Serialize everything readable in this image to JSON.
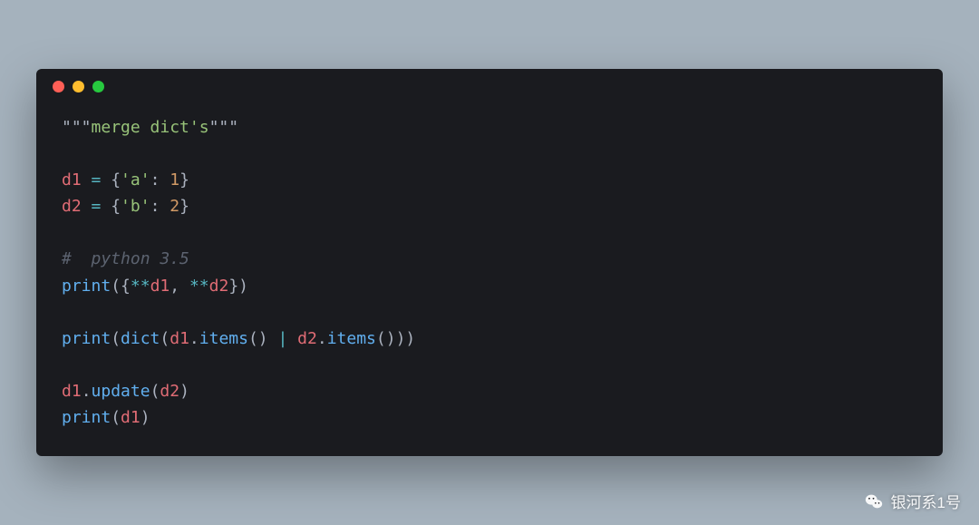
{
  "colors": {
    "page_bg": "#a5b2bd",
    "window_bg": "#1a1b1f",
    "dot_red": "#ff5f56",
    "dot_yellow": "#ffbd2e",
    "dot_green": "#27c93f",
    "string": "#98c379",
    "variable": "#e06c75",
    "operator": "#56b6c2",
    "number": "#d19a66",
    "comment": "#5c6370",
    "function": "#61afef",
    "text": "#abb2bf"
  },
  "code": {
    "docstring_quote": "\"\"\"",
    "docstring_text": "merge dict's",
    "d1_name": "d1",
    "d2_name": "d2",
    "eq": " = ",
    "lbrace": "{",
    "rbrace": "}",
    "key_a": "'a'",
    "key_b": "'b'",
    "colon": ": ",
    "val_1": "1",
    "val_2": "2",
    "comment_line": "#  python 3.5",
    "print": "print",
    "lparen": "(",
    "rparen": ")",
    "star2": "**",
    "comma_sp": ", ",
    "dict": "dict",
    "dot": ".",
    "items": "items",
    "pipe": " | ",
    "update": "update"
  },
  "watermark": {
    "text": "银河系1号",
    "icon": "wechat-icon"
  }
}
